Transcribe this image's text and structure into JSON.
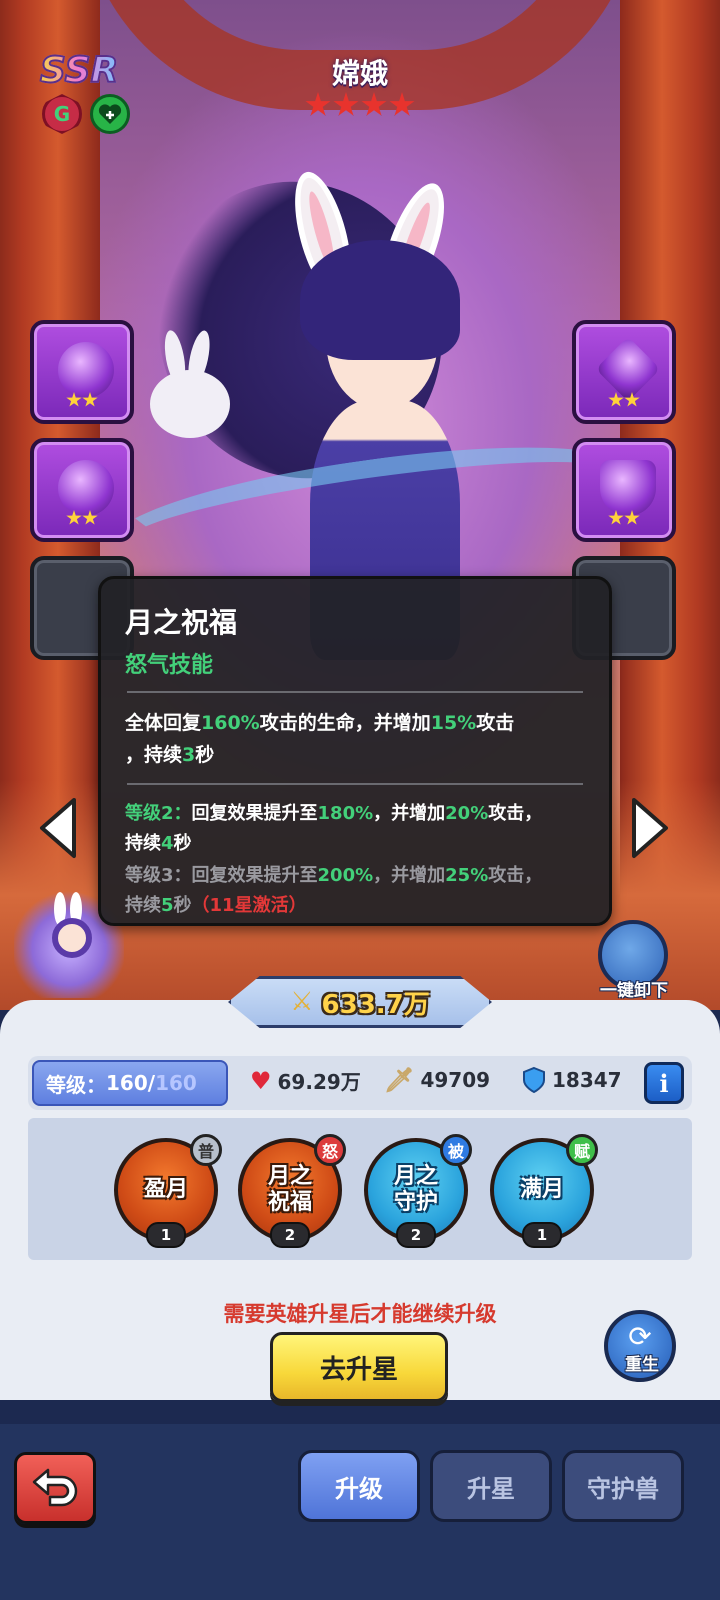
{
  "hero": {
    "rarity": "SSR",
    "faction_badge": "G",
    "class_icon": "heart-plus-icon",
    "name": "嫦娥",
    "stars": 4
  },
  "equipment": {
    "left": [
      {
        "icon": "amulet-icon",
        "stars": 2
      },
      {
        "icon": "ring-icon",
        "stars": 2
      },
      {
        "icon": "locked-slot-icon",
        "stars": 0
      }
    ],
    "right": [
      {
        "icon": "crystal-charm-icon",
        "stars": 2
      },
      {
        "icon": "chalice-icon",
        "stars": 2
      },
      {
        "icon": "locked-slot-icon",
        "stars": 0
      }
    ]
  },
  "tooltip": {
    "title": "月之祝福",
    "type": "怒气技能",
    "description": [
      "全体回复",
      "160%",
      "攻击的生命，并增加",
      "15%",
      "攻击",
      "，持续",
      "3",
      "秒"
    ],
    "levels": [
      {
        "label": "等级2：",
        "parts": [
          "回复效果提升至",
          "180%",
          "，并增加",
          "20%",
          "攻击，",
          "持续",
          "4",
          "秒"
        ],
        "active": true,
        "note": ""
      },
      {
        "label": "等级3：",
        "parts": [
          "回复效果提升至",
          "200%",
          "，并增加",
          "25%",
          "攻击，",
          "持续",
          "5",
          "秒"
        ],
        "active": false,
        "note": "（11星激活）"
      }
    ]
  },
  "unequip_all": "一键卸下",
  "power": "633.7万",
  "stats": {
    "level_label": "等级：",
    "level": "160",
    "level_sep": "/",
    "level_max": "160",
    "hp": "69.29万",
    "attack": "49709",
    "defense": "18347",
    "info_icon": "i"
  },
  "skills": [
    {
      "name": "盈月",
      "tag": "普",
      "level": "1",
      "style": "fire",
      "badge": "gray"
    },
    {
      "name_lines": [
        "月之",
        "祝福"
      ],
      "tag": "怒",
      "level": "2",
      "style": "fire",
      "badge": "red"
    },
    {
      "name_lines": [
        "月之",
        "守护"
      ],
      "tag": "被",
      "level": "2",
      "style": "ice",
      "badge": "blue"
    },
    {
      "name": "满月",
      "tag": "赋",
      "level": "1",
      "style": "ice",
      "badge": "green"
    }
  ],
  "notice": "需要英雄升星后才能继续升级",
  "go_star_button": "去升星",
  "rebirth": "重生",
  "nav": {
    "tabs": [
      "升级",
      "升星",
      "守护兽"
    ],
    "active": 0
  },
  "colors": {
    "accent_green": "#43d07a",
    "warn_red": "#d63a2e",
    "panel_bg": "#e9edf4",
    "nav_bg": "#23345f"
  }
}
